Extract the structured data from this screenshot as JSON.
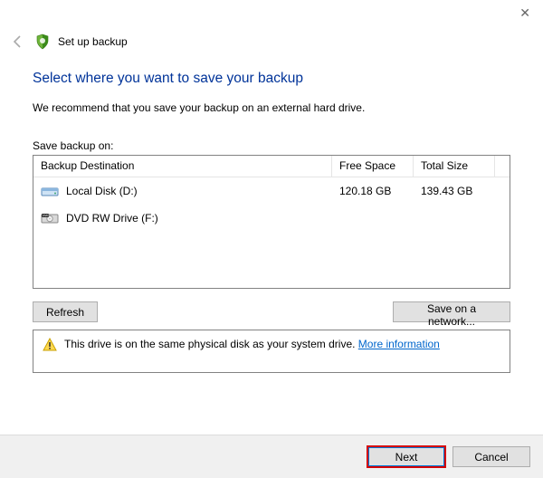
{
  "window": {
    "title": "Set up backup"
  },
  "heading": "Select where you want to save your backup",
  "recommendation": "We recommend that you save your backup on an external hard drive.",
  "save_on_label": "Save backup on:",
  "table": {
    "headers": {
      "destination": "Backup Destination",
      "free": "Free Space",
      "total": "Total Size"
    },
    "rows": [
      {
        "icon": "hdd",
        "name": "Local Disk (D:)",
        "free": "120.18 GB",
        "total": "139.43 GB"
      },
      {
        "icon": "dvd",
        "name": "DVD RW Drive (F:)",
        "free": "",
        "total": ""
      }
    ]
  },
  "buttons": {
    "refresh": "Refresh",
    "save_network": "Save on a network...",
    "next": "Next",
    "cancel": "Cancel"
  },
  "info": {
    "text": "This drive is on the same physical disk as your system drive. ",
    "link": "More information"
  }
}
